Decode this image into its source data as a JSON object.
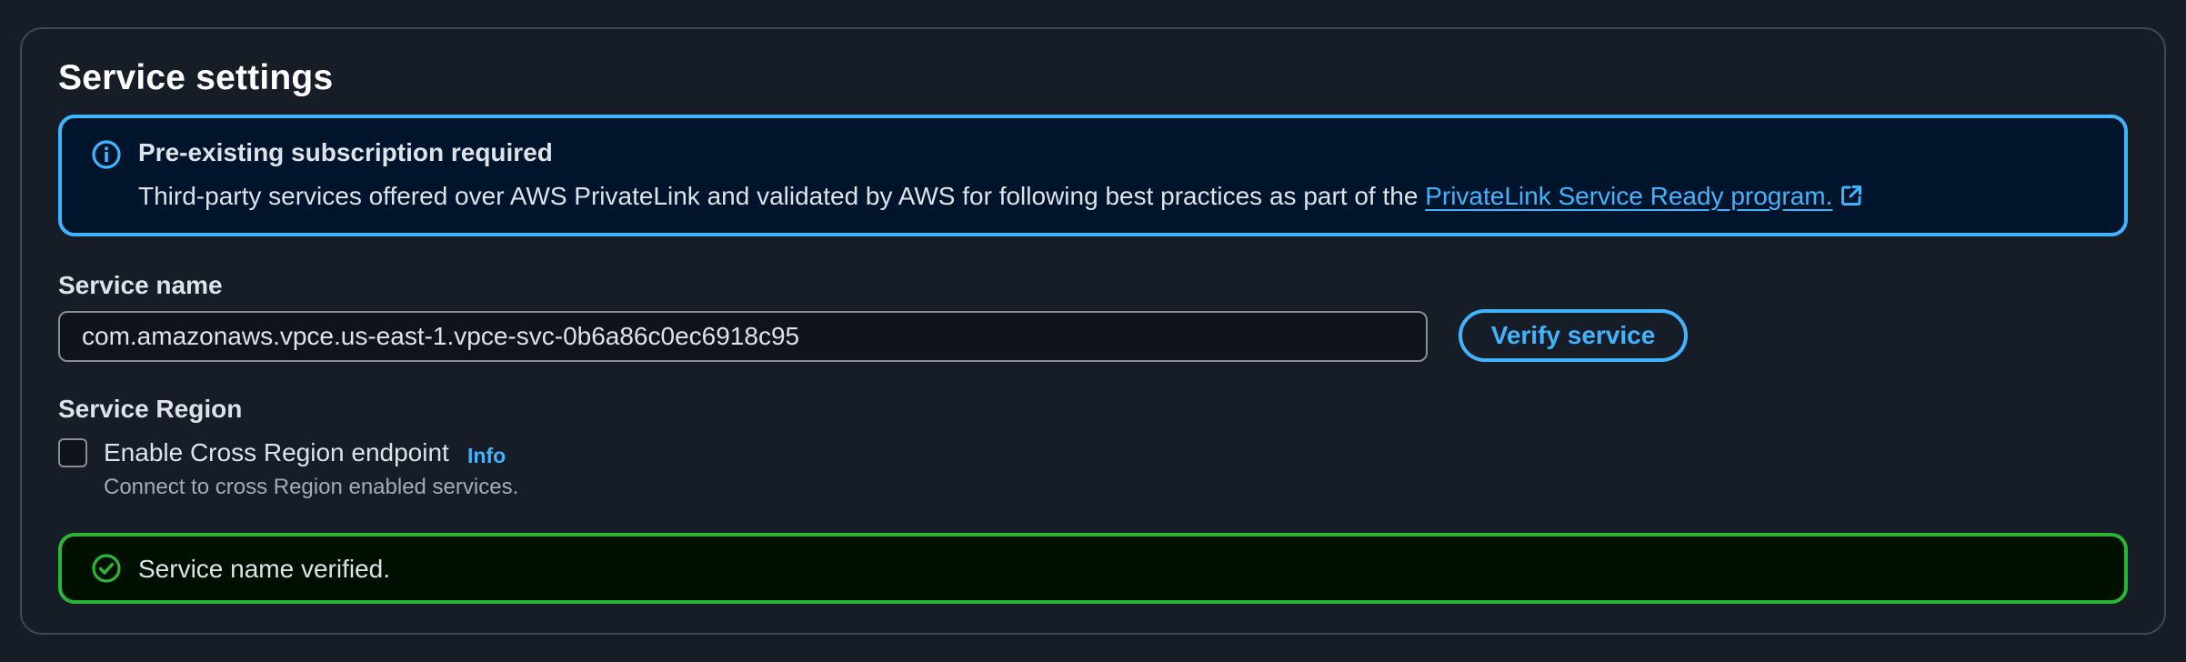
{
  "panel": {
    "title": "Service settings"
  },
  "info_alert": {
    "icon": "info-icon",
    "title": "Pre-existing subscription required",
    "body": "Third-party services offered over AWS PrivateLink and validated by AWS for following best practices as part of the ",
    "link_text": "PrivateLink Service Ready program.",
    "link_icon": "external-link-icon"
  },
  "service_name": {
    "label": "Service name",
    "value": "com.amazonaws.vpce.us-east-1.vpce-svc-0b6a86c0ec6918c95",
    "verify_label": "Verify service"
  },
  "service_region": {
    "label": "Service Region",
    "checkbox_label": "Enable Cross Region endpoint",
    "checkbox_checked": false,
    "info_label": "Info",
    "description": "Connect to cross Region enabled services."
  },
  "success_alert": {
    "icon": "check-circle-icon",
    "message": "Service name verified."
  },
  "colors": {
    "background": "#161d26",
    "accent_blue": "#42b4ff",
    "info_bg": "#00142b",
    "success_green": "#2bb534",
    "success_bg": "#001000",
    "text": "#dee3ea",
    "muted_text": "#a4abb5"
  }
}
